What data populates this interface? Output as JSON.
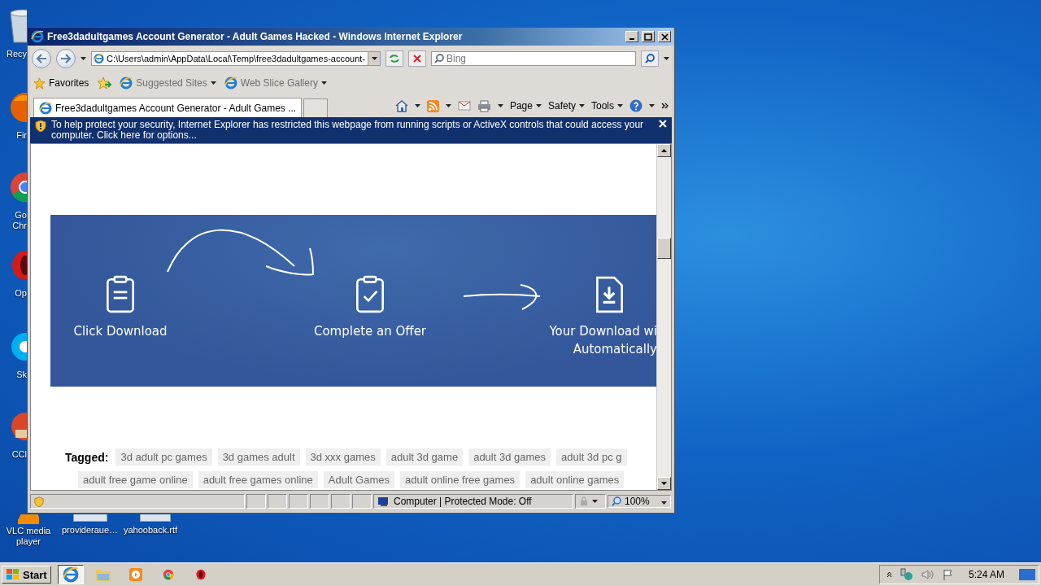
{
  "desktop_icons": [
    {
      "label": "Recy",
      "kind": "recycle"
    },
    {
      "label": "Fir",
      "kind": "firefox"
    },
    {
      "label": "Go\nChr",
      "kind": "chrome"
    },
    {
      "label": "Op",
      "kind": "opera"
    },
    {
      "label": "Sk",
      "kind": "skype"
    },
    {
      "label": "CCl",
      "kind": "ccleaner"
    },
    {
      "label": "VLC media\nplayer",
      "kind": "vlc"
    }
  ],
  "desktop_files": [
    {
      "label": "provideraue…"
    },
    {
      "label": "yahooback.rtf"
    }
  ],
  "window": {
    "title": "Free3dadultgames Account Generator - Adult Games Hacked - Windows Internet Explorer",
    "address": "C:\\Users\\admin\\AppData\\Local\\Temp\\free3dadultgames-account-",
    "search": {
      "placeholder": "Bing"
    },
    "favorites": {
      "label": "Favorites",
      "links": [
        "Suggested Sites",
        "Web Slice Gallery"
      ]
    },
    "tabs": [
      {
        "label": "Free3dadultgames Account Generator - Adult Games ...",
        "selected": true
      }
    ],
    "commands": [
      "Page",
      "Safety",
      "Tools"
    ],
    "infobar": "To help protect your security, Internet Explorer has restricted this webpage from running scripts or ActiveX controls that could access your computer. Click here for options...",
    "page": {
      "steps": [
        {
          "kind": "list",
          "lines": [
            "Click Download"
          ]
        },
        {
          "kind": "check",
          "lines": [
            "Complete an Offer"
          ]
        },
        {
          "kind": "download",
          "lines": [
            "Your Download wi",
            "Automatically"
          ]
        }
      ],
      "tagged_label": "Tagged:",
      "tag_rows": [
        [
          "3d adult pc games",
          "3d games adult",
          "3d xxx games",
          "adult 3d game",
          "adult 3d games",
          "adult 3d pc g"
        ],
        [
          "adult free game online",
          "adult free games online",
          "Adult Games",
          "adult online free games",
          "adult online games"
        ]
      ]
    },
    "status_bar": {
      "zone": "Computer | Protected Mode: Off",
      "zoom": "100%"
    }
  },
  "taskbar": {
    "start": "Start",
    "apps": [
      {
        "kind": "ie",
        "selected": true
      },
      {
        "kind": "explorer",
        "selected": false
      },
      {
        "kind": "media",
        "selected": false
      },
      {
        "kind": "chrome",
        "selected": false
      },
      {
        "kind": "opera",
        "selected": false
      }
    ],
    "clock": "5:24 AM"
  }
}
